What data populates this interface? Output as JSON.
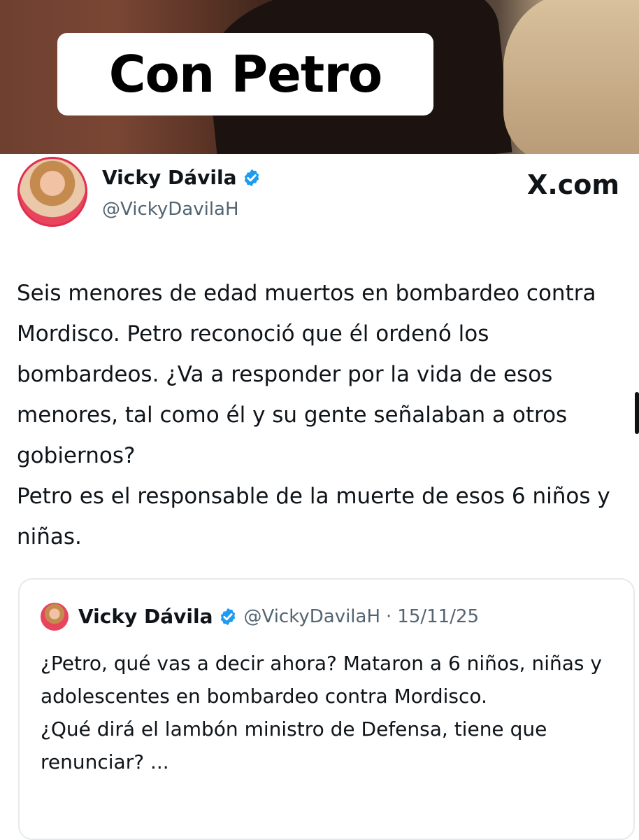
{
  "banner": {
    "text": "Con Petro"
  },
  "tweet": {
    "author_name": "Vicky Dávila",
    "author_handle": "@VickyDavilaH",
    "site_label": "X.com",
    "paragraphs": [
      "Seis menores de edad muertos en bombardeo contra Mordisco. Petro reconoció que él  ordenó los bombardeos. ¿Va a responder por la vida de esos menores, tal como él y su gente señalaban a otros gobiernos?",
      "Petro es el responsable de la muerte de esos 6 niños y niñas."
    ]
  },
  "quoted_tweet": {
    "author_name": "Vicky Dávila",
    "author_handle": "@VickyDavilaH",
    "separator": "·",
    "date": "15/11/25",
    "paragraphs": [
      "¿Petro, qué vas a decir ahora? Mataron a 6 niños, niñas y adolescentes en bombardeo contra Mordisco.",
      "¿Qué dirá el lambón ministro de Defensa, tiene que renunciar? ..."
    ]
  },
  "icons": {
    "verified": "verified-badge-icon",
    "brand_color": "#1d9bf0"
  }
}
